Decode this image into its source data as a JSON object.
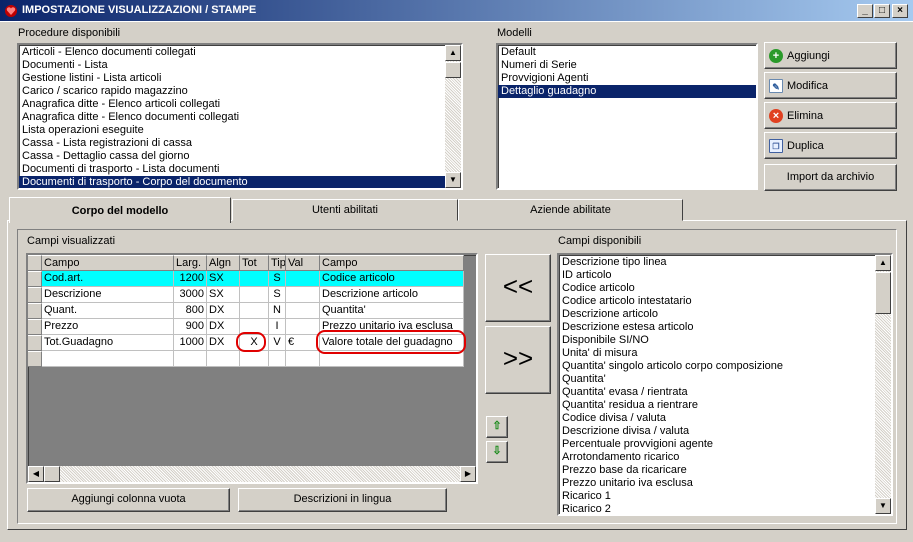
{
  "window": {
    "title": "IMPOSTAZIONE VISUALIZZAZIONI / STAMPE",
    "min": "_",
    "max": "□",
    "close": "×"
  },
  "procedures": {
    "label": "Procedure disponibili",
    "items": [
      "Articoli - Elenco documenti collegati",
      "Documenti - Lista",
      "Gestione listini - Lista articoli",
      "Carico / scarico rapido magazzino",
      "Anagrafica ditte - Elenco articoli collegati",
      "Anagrafica ditte - Elenco documenti collegati",
      "Lista operazioni eseguite",
      "Cassa - Lista registrazioni di cassa",
      "Cassa - Dettaglio cassa del giorno",
      "Documenti di trasporto - Lista documenti",
      "Documenti di trasporto - Corpo del documento"
    ],
    "selected_index": 10
  },
  "models": {
    "label": "Modelli",
    "items": [
      "Default",
      "Numeri di Serie",
      "Provvigioni Agenti",
      "Dettaglio guadagno"
    ],
    "selected_index": 3
  },
  "buttons": {
    "add": "Aggiungi",
    "edit": "Modifica",
    "delete": "Elimina",
    "duplicate": "Duplica",
    "import": "Import da archivio",
    "move_left": "<<",
    "move_right": ">>",
    "add_empty_column": "Aggiungi colonna vuota",
    "descriptions_language": "Descrizioni in lingua"
  },
  "tabs": [
    "Corpo del modello",
    "Utenti abilitati",
    "Aziende abilitate"
  ],
  "visible_fields": {
    "label": "Campi visualizzati",
    "headers": [
      "Campo",
      "Larg.",
      "Algn",
      "Tot",
      "Tip",
      "Val",
      "Campo"
    ],
    "rows": [
      [
        "Cod.art.",
        "1200",
        "SX",
        "",
        "S",
        "",
        "Codice articolo"
      ],
      [
        "Descrizione",
        "3000",
        "SX",
        "",
        "S",
        "",
        "Descrizione articolo"
      ],
      [
        "Quant.",
        "800",
        "DX",
        "",
        "N",
        "",
        "Quantita'"
      ],
      [
        "Prezzo",
        "900",
        "DX",
        "",
        "I",
        "",
        "Prezzo unitario iva esclusa"
      ],
      [
        "Tot.Guadagno",
        "1000",
        "DX",
        "X",
        "V",
        "€",
        "Valore totale del guadagno"
      ]
    ],
    "highlight_color": "#00ffff"
  },
  "available_fields": {
    "label": "Campi disponibili",
    "items": [
      "Descrizione tipo linea",
      "ID articolo",
      "Codice articolo",
      "Codice articolo intestatario",
      "Descrizione articolo",
      "Descrizione estesa articolo",
      "Disponibile SI/NO",
      "Unita' di misura",
      "Quantita' singolo articolo corpo composizione",
      "Quantita'",
      "Quantita' evasa / rientrata",
      "Quantita' residua a rientrare",
      "Codice divisa / valuta",
      "Descrizione divisa / valuta",
      "Percentuale provvigioni agente",
      "Arrotondamento ricarico",
      "Prezzo base da ricaricare",
      "Prezzo unitario iva esclusa",
      "Ricarico 1",
      "Ricarico 2"
    ]
  },
  "icons": {
    "app": "heart-icon",
    "add": "plus-circle-icon",
    "edit": "edit-icon",
    "delete": "delete-circle-icon",
    "duplicate": "duplicate-icon",
    "up": "arrow-up-icon",
    "down": "arrow-down-icon"
  }
}
